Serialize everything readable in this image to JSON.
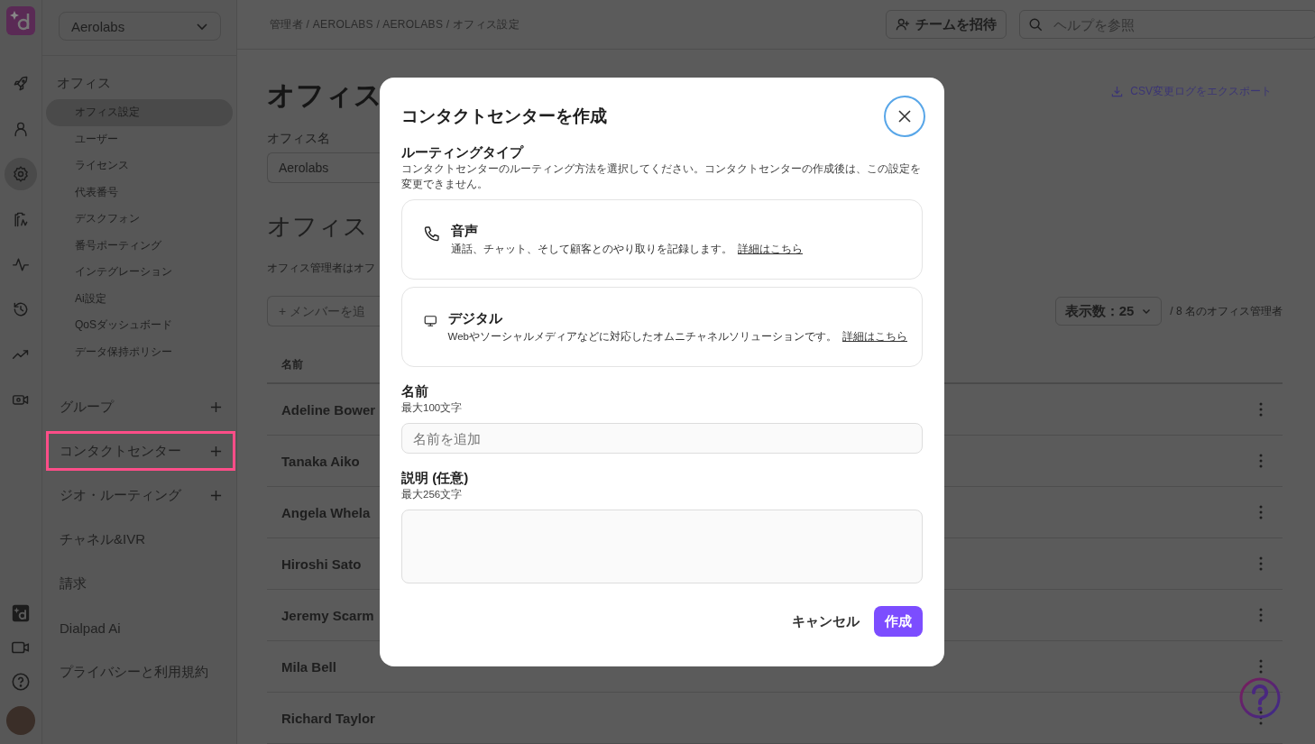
{
  "rail": {
    "top": [
      {
        "kind": "rocket",
        "selected": false
      },
      {
        "kind": "person",
        "selected": false
      },
      {
        "kind": "gear",
        "selected": true
      },
      {
        "kind": "contacts",
        "selected": false
      },
      {
        "kind": "pulse",
        "selected": false
      },
      {
        "kind": "history",
        "selected": false
      },
      {
        "kind": "trend",
        "selected": false
      },
      {
        "kind": "video-gear",
        "selected": false
      }
    ],
    "bottom": [
      {
        "kind": "app"
      },
      {
        "kind": "video"
      },
      {
        "kind": "help"
      },
      {
        "kind": "avatar"
      }
    ]
  },
  "sidebar": {
    "office_select": "Aerolabs",
    "office_section": {
      "label": "オフィス",
      "items": [
        {
          "label": "オフィス設定",
          "selected": true
        },
        {
          "label": "ユーザー",
          "selected": false
        },
        {
          "label": "ライセンス",
          "selected": false
        },
        {
          "label": "代表番号",
          "selected": false
        },
        {
          "label": "デスクフォン",
          "selected": false
        },
        {
          "label": "番号ポーティング",
          "selected": false
        },
        {
          "label": "インテグレーション",
          "selected": false
        },
        {
          "label": "Ai設定",
          "selected": false
        },
        {
          "label": "QoSダッシュボード",
          "selected": false
        },
        {
          "label": "データ保持ポリシー",
          "selected": false
        }
      ]
    },
    "sections": [
      {
        "label": "グループ",
        "add": true,
        "highlighted": false
      },
      {
        "label": "コンタクトセンター",
        "add": true,
        "highlighted": true
      },
      {
        "label": "ジオ・ルーティング",
        "add": true,
        "highlighted": false
      },
      {
        "label": "チャネル&IVR",
        "add": false,
        "highlighted": false
      },
      {
        "label": "請求",
        "add": false,
        "highlighted": false
      },
      {
        "label": "Dialpad Ai",
        "add": false,
        "highlighted": false
      },
      {
        "label": "プライバシーと利用規約",
        "add": false,
        "highlighted": false
      }
    ]
  },
  "topbar": {
    "breadcrumb": "管理者 / AEROLABS / AEROLABS / オフィス設定",
    "invite_button": "チームを招待",
    "search": {
      "placeholder": "ヘルプを参照"
    }
  },
  "main": {
    "title": "オフィス",
    "office_name_label": "オフィス名",
    "office_name_value": "Aerolabs",
    "admins_heading": "オフィス",
    "admins_description": "オフィス管理者はオフ",
    "add_member_placeholder": "+ メンバーを追",
    "export_link": "CSV変更ログをエクスポート",
    "page_size": "表示数：25",
    "total": "/ 8 名のオフィス管理者",
    "table": {
      "columns": [
        "名前"
      ],
      "rows": [
        "Adeline Bower",
        "Tanaka Aiko",
        "Angela Whela",
        "Hiroshi Sato",
        "Jeremy Scarm",
        "Mila Bell",
        "Richard Taylor"
      ]
    }
  },
  "modal": {
    "title": "コンタクトセンターを作成",
    "routing_label": "ルーティングタイプ",
    "routing_description": "コンタクトセンターのルーティング方法を選択してください。コンタクトセンターの作成後は、この設定を変更できません。",
    "options": [
      {
        "kind": "voice",
        "title": "音声",
        "description": "通話、チャット、そして顧客とのやり取りを記録します。",
        "link": "詳細はこちら"
      },
      {
        "kind": "digital",
        "title": "デジタル",
        "description": "Webやソーシャルメディアなどに対応したオムニチャネルソリューションです。",
        "link": "詳細はこちら"
      }
    ],
    "name_label": "名前",
    "name_hint": "最大100文字",
    "name_placeholder": "名前を追加",
    "description_label": "説明 (任意)",
    "description_hint": "最大256文字",
    "cancel_button": "キャンセル",
    "create_button": "作成"
  }
}
